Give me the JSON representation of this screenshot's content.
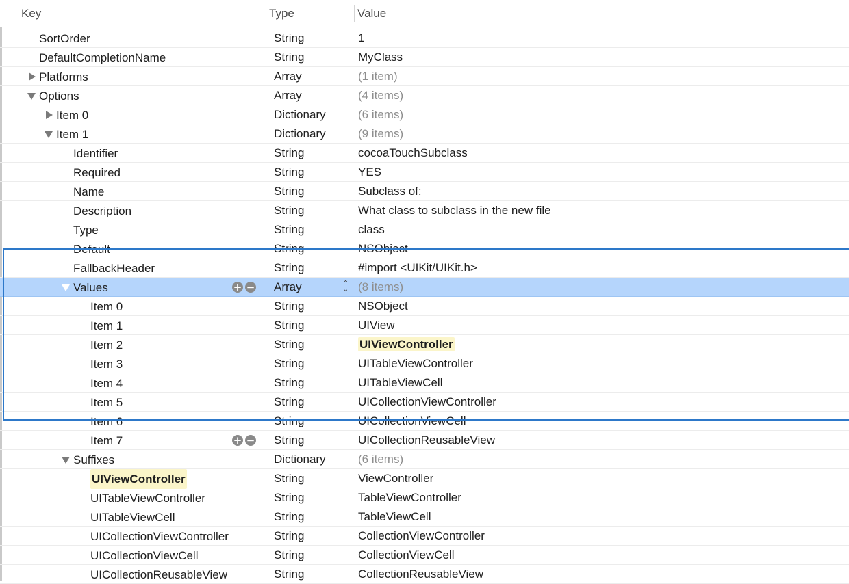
{
  "columns": {
    "key": "Key",
    "type": "Type",
    "value": "Value"
  },
  "rows": [
    {
      "key": "SortOrder",
      "type": "String",
      "value": "1",
      "indent": 0,
      "disclosure": "none",
      "muted": false
    },
    {
      "key": "DefaultCompletionName",
      "type": "String",
      "value": "MyClass",
      "indent": 0,
      "disclosure": "none",
      "muted": false
    },
    {
      "key": "Platforms",
      "type": "Array",
      "value": "(1 item)",
      "indent": 0,
      "disclosure": "closed",
      "muted": true
    },
    {
      "key": "Options",
      "type": "Array",
      "value": "(4 items)",
      "indent": 0,
      "disclosure": "open",
      "muted": true
    },
    {
      "key": "Item 0",
      "type": "Dictionary",
      "value": "(6 items)",
      "indent": 1,
      "disclosure": "closed",
      "muted": true
    },
    {
      "key": "Item 1",
      "type": "Dictionary",
      "value": "(9 items)",
      "indent": 1,
      "disclosure": "open",
      "muted": true
    },
    {
      "key": "Identifier",
      "type": "String",
      "value": "cocoaTouchSubclass",
      "indent": 2,
      "disclosure": "none",
      "muted": false
    },
    {
      "key": "Required",
      "type": "String",
      "value": "YES",
      "indent": 2,
      "disclosure": "none",
      "muted": false
    },
    {
      "key": "Name",
      "type": "String",
      "value": "Subclass of:",
      "indent": 2,
      "disclosure": "none",
      "muted": false
    },
    {
      "key": "Description",
      "type": "String",
      "value": "What class to subclass in the new file",
      "indent": 2,
      "disclosure": "none",
      "muted": false
    },
    {
      "key": "Type",
      "type": "String",
      "value": "class",
      "indent": 2,
      "disclosure": "none",
      "muted": false
    },
    {
      "key": "Default",
      "type": "String",
      "value": "NSObject",
      "indent": 2,
      "disclosure": "none",
      "muted": false
    },
    {
      "key": "FallbackHeader",
      "type": "String",
      "value": "#import <UIKit/UIKit.h>",
      "indent": 2,
      "disclosure": "none",
      "muted": false
    },
    {
      "key": "Values",
      "type": "Array",
      "value": "(8 items)",
      "indent": 2,
      "disclosure": "open",
      "muted": true,
      "selected": true,
      "controls": true,
      "stepper": true
    },
    {
      "key": "Item 0",
      "type": "String",
      "value": "NSObject",
      "indent": 3,
      "disclosure": "none",
      "muted": false
    },
    {
      "key": "Item 1",
      "type": "String",
      "value": "UIView",
      "indent": 3,
      "disclosure": "none",
      "muted": false
    },
    {
      "key": "Item 2",
      "type": "String",
      "value": "UIViewController",
      "indent": 3,
      "disclosure": "none",
      "muted": false,
      "highlight_value": true
    },
    {
      "key": "Item 3",
      "type": "String",
      "value": "UITableViewController",
      "indent": 3,
      "disclosure": "none",
      "muted": false
    },
    {
      "key": "Item 4",
      "type": "String",
      "value": "UITableViewCell",
      "indent": 3,
      "disclosure": "none",
      "muted": false
    },
    {
      "key": "Item 5",
      "type": "String",
      "value": "UICollectionViewController",
      "indent": 3,
      "disclosure": "none",
      "muted": false
    },
    {
      "key": "Item 6",
      "type": "String",
      "value": "UICollectionViewCell",
      "indent": 3,
      "disclosure": "none",
      "muted": false
    },
    {
      "key": "Item 7",
      "type": "String",
      "value": "UICollectionReusableView",
      "indent": 3,
      "disclosure": "none",
      "muted": false,
      "controls": true
    },
    {
      "key": "Suffixes",
      "type": "Dictionary",
      "value": "(6 items)",
      "indent": 2,
      "disclosure": "open",
      "muted": true
    },
    {
      "key": "UIViewController",
      "type": "String",
      "value": "ViewController",
      "indent": 3,
      "disclosure": "none",
      "muted": false,
      "highlight_key": true
    },
    {
      "key": "UITableViewController",
      "type": "String",
      "value": "TableViewController",
      "indent": 3,
      "disclosure": "none",
      "muted": false
    },
    {
      "key": "UITableViewCell",
      "type": "String",
      "value": "TableViewCell",
      "indent": 3,
      "disclosure": "none",
      "muted": false
    },
    {
      "key": "UICollectionViewController",
      "type": "String",
      "value": "CollectionViewController",
      "indent": 3,
      "disclosure": "none",
      "muted": false
    },
    {
      "key": "UICollectionViewCell",
      "type": "String",
      "value": "CollectionViewCell",
      "indent": 3,
      "disclosure": "none",
      "muted": false
    },
    {
      "key": "UICollectionReusableView",
      "type": "String",
      "value": "CollectionReusableView",
      "indent": 3,
      "disclosure": "none",
      "muted": false
    }
  ],
  "controls": {
    "add_icon": "plus-circle-icon",
    "remove_icon": "minus-circle-icon",
    "stepper_icon": "up-down-stepper-icon"
  },
  "colors": {
    "selection": "#b5d5fc",
    "group_border": "#2d78c9",
    "highlight": "#fbf5c9",
    "muted_text": "#8e8e8e"
  }
}
